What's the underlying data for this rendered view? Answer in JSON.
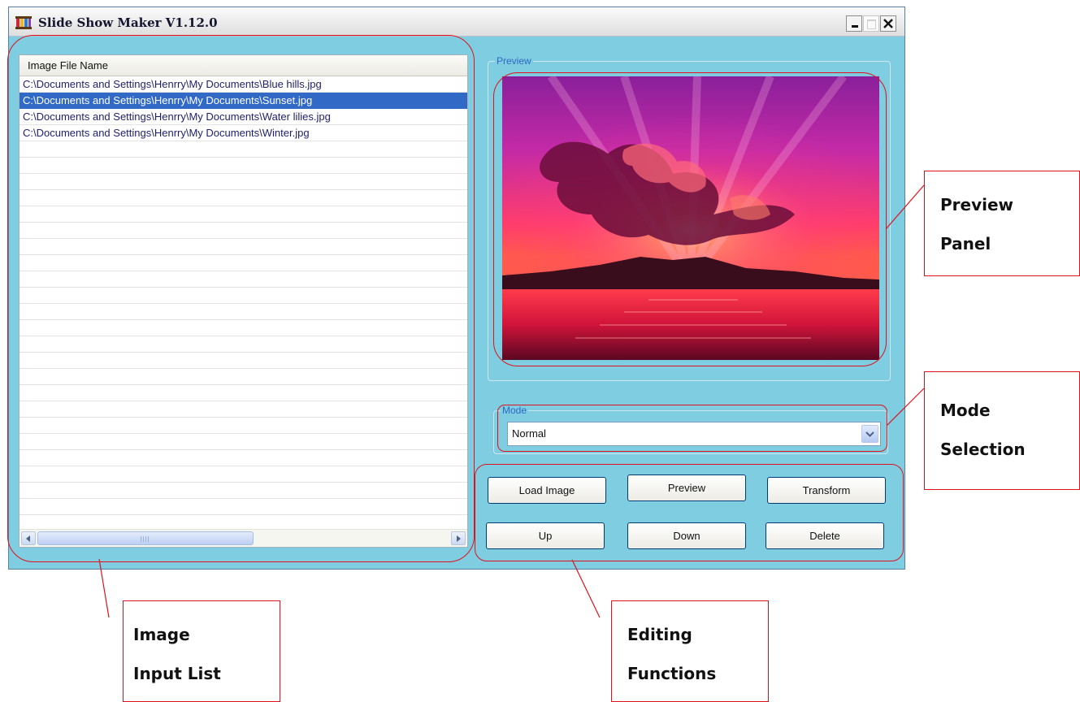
{
  "window": {
    "title": "Slide Show Maker V1.12.0",
    "controls": {
      "minimize": "minimize-icon",
      "maximize": "maximize-icon",
      "close": "close-icon"
    }
  },
  "list": {
    "header": "Image File Name",
    "items": [
      "C:\\Documents and Settings\\Henrry\\My Documents\\Blue hills.jpg",
      "C:\\Documents and Settings\\Henrry\\My Documents\\Sunset.jpg",
      "C:\\Documents and Settings\\Henrry\\My Documents\\Water lilies.jpg",
      "C:\\Documents and Settings\\Henrry\\My Documents\\Winter.jpg"
    ],
    "selected_index": 1
  },
  "preview": {
    "label": "Preview",
    "image": "sunset-photo"
  },
  "mode": {
    "label": "Mode",
    "value": "Normal"
  },
  "buttons": {
    "load_image": "Load Image",
    "preview": "Preview",
    "transform": "Transform",
    "up": "Up",
    "down": "Down",
    "delete": "Delete"
  },
  "annotations": {
    "preview_panel": [
      "Preview",
      "Panel"
    ],
    "mode_selection": [
      "Mode",
      "Selection"
    ],
    "image_input_list": [
      "Image",
      "Input List"
    ],
    "editing_functions": [
      "Editing",
      "Functions"
    ]
  },
  "colors": {
    "window_bg": "#7ecde0",
    "selection": "#3169c6",
    "group_label": "#2f67c6",
    "callout": "#e0111b"
  }
}
